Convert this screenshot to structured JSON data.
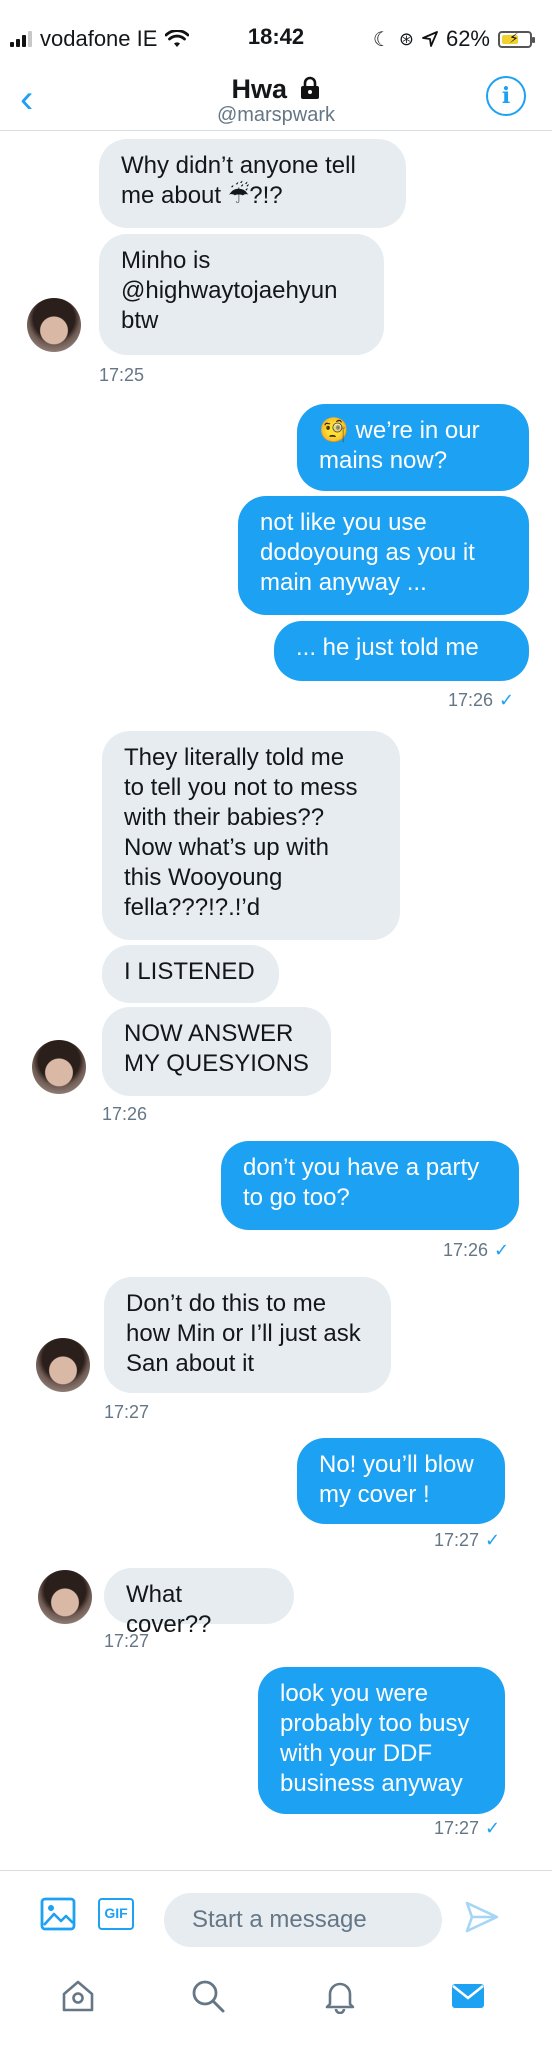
{
  "status": {
    "carrier": "vodafone IE",
    "time": "18:42",
    "battery": "62%",
    "battery_level": 0.62
  },
  "header": {
    "title": "Hwa",
    "handle": "@marspwark"
  },
  "messages": [
    {
      "dir": "in",
      "text": "Why didn’t anyone tell\nme about ☔?!?"
    },
    {
      "dir": "in",
      "text": "Minho is\n@highwaytojaehyun\nbtw"
    },
    {
      "ts": "17:25"
    },
    {
      "dir": "out",
      "text": "🧐 we’re in our\nmains now?"
    },
    {
      "dir": "out",
      "text": "not like you use\ndodoyoung as you it\nmain anyway ..."
    },
    {
      "dir": "out",
      "text": "... he just told me"
    },
    {
      "ts": "17:26"
    },
    {
      "dir": "in",
      "text": "They literally told me\nto tell you not to mess\nwith their babies??\nNow what’s up with\nthis Wooyoung\nfella???!?.!’d"
    },
    {
      "dir": "in",
      "text": "I LISTENED"
    },
    {
      "dir": "in",
      "text": "NOW ANSWER\nMY QUESYIONS"
    },
    {
      "ts": "17:26"
    },
    {
      "dir": "out",
      "text": "don’t you have a party\nto go too?"
    },
    {
      "ts": "17:26"
    },
    {
      "dir": "in",
      "text": "Don’t do this to me\nhow Min or I’ll just ask\nSan about it"
    },
    {
      "ts": "17:27"
    },
    {
      "dir": "out",
      "text": "No! you’ll blow\nmy cover !"
    },
    {
      "ts": "17:27"
    },
    {
      "dir": "in",
      "text": "What cover??"
    },
    {
      "ts": "17:27"
    },
    {
      "dir": "out",
      "text": "look you were\nprobably too busy\nwith your DDF\nbusiness anyway"
    },
    {
      "ts": "17:27"
    }
  ],
  "composer": {
    "placeholder": "Start a message",
    "gif_label": "GIF"
  },
  "colors": {
    "accent": "#1da1f2",
    "incoming_bubble": "#e6ecf0",
    "muted": "#657786"
  },
  "icons": {
    "back": "chevron-left-icon",
    "info": "info-icon",
    "image": "image-icon",
    "gif": "gif-icon",
    "send": "send-icon",
    "home": "home-icon",
    "search": "search-icon",
    "notifications": "bell-icon",
    "messages": "mail-icon"
  }
}
